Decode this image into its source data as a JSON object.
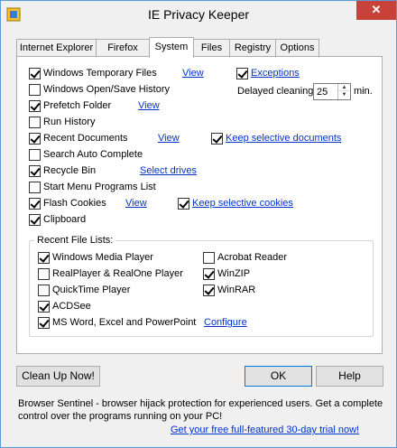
{
  "window": {
    "title": "IE Privacy Keeper",
    "close_label": "✕"
  },
  "tabs": [
    {
      "label": "Internet Explorer",
      "active": false
    },
    {
      "label": "Firefox",
      "active": false
    },
    {
      "label": "System",
      "active": true
    },
    {
      "label": "Files",
      "active": false
    },
    {
      "label": "Registry",
      "active": false
    },
    {
      "label": "Options",
      "active": false
    }
  ],
  "system_options": [
    {
      "label": "Windows Temporary Files",
      "checked": true,
      "link": "View"
    },
    {
      "label": "Windows Open/Save History",
      "checked": false
    },
    {
      "label": "Prefetch Folder",
      "checked": true,
      "link": "View"
    },
    {
      "label": "Run History",
      "checked": false
    },
    {
      "label": "Recent Documents",
      "checked": true,
      "link": "View",
      "extra": {
        "label": "Keep selective documents",
        "checked": true
      }
    },
    {
      "label": "Search Auto Complete",
      "checked": false
    },
    {
      "label": "Recycle Bin",
      "checked": true,
      "link": "Select drives"
    },
    {
      "label": "Start Menu Programs List",
      "checked": false
    },
    {
      "label": "Flash Cookies",
      "checked": true,
      "link": "View",
      "extra": {
        "label": "Keep selective cookies",
        "checked": true
      }
    },
    {
      "label": "Clipboard",
      "checked": true
    }
  ],
  "exceptions": {
    "label": "Exceptions",
    "checked": true
  },
  "delayed_cleaning": {
    "label": "Delayed cleaning:",
    "value": "25",
    "unit": "min."
  },
  "recent_file_lists": {
    "title": "Recent File Lists:",
    "left": [
      {
        "label": "Windows Media Player",
        "checked": true
      },
      {
        "label": "RealPlayer & RealOne Player",
        "checked": false
      },
      {
        "label": "QuickTime Player",
        "checked": false
      },
      {
        "label": "ACDSee",
        "checked": true
      },
      {
        "label": "MS Word, Excel and PowerPoint",
        "checked": true
      }
    ],
    "right": [
      {
        "label": "Acrobat Reader",
        "checked": false
      },
      {
        "label": "WinZIP",
        "checked": true
      },
      {
        "label": "WinRAR",
        "checked": true
      }
    ],
    "configure_link": "Configure"
  },
  "buttons": {
    "clean_up": "Clean Up Now!",
    "ok": "OK",
    "help": "Help"
  },
  "footer": {
    "text": "Browser Sentinel - browser hijack protection for experienced users. Get a complete control over the programs running on your PC!",
    "link": "Get your free full-featured 30-day trial now!"
  }
}
